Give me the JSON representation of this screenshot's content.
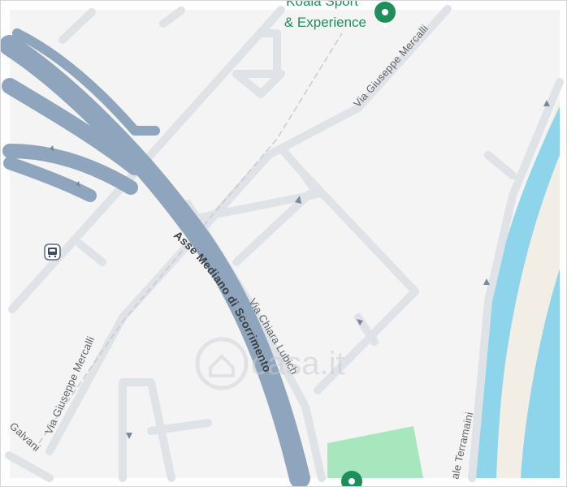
{
  "streets": {
    "mercalli_upper": "Via Giuseppe Mercalli",
    "mercalli_lower": "Via Giuseppe Mercalli",
    "chiara_lubich": "Via Chiara Lubich",
    "asse_mediano": "Asse Mediano di Scorrimento",
    "terramaini": "ale Terramaini",
    "galvani": "Galvani"
  },
  "poi": {
    "line1": "Koala Sport",
    "line2": "& Experience"
  },
  "watermark": "casa.it",
  "colors": {
    "background": "#f4f4f4",
    "road": "#dfe3e8",
    "highway": "#8fa4bd",
    "river": "#8ed4ea",
    "riverbank": "#f2eee6",
    "park": "#a8e6bd",
    "poi_green": "#1e8e5a"
  },
  "icons": {
    "bus_stop": "bus-stop-icon",
    "poi_marker": "poi-marker-icon",
    "poi_marker_bottom": "poi-marker-bottom-icon"
  }
}
